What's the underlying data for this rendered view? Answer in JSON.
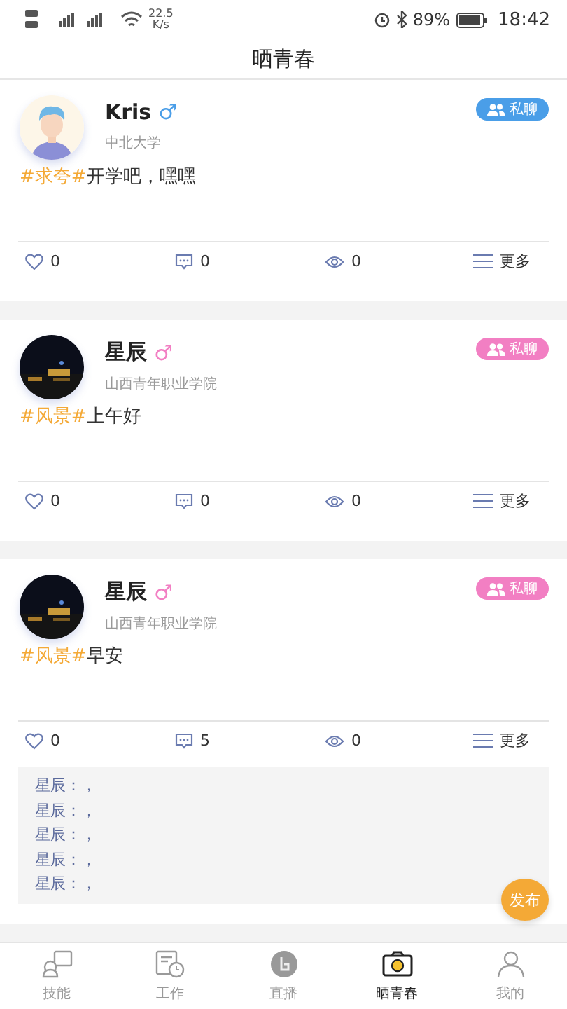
{
  "status_bar": {
    "speed": "22.5",
    "speed_unit": "K/s",
    "battery": "89%",
    "time": "18:42"
  },
  "header": {
    "title": "晒青春"
  },
  "posts": [
    {
      "name": "Kris",
      "gender": "♂",
      "color": "#4a9ee8",
      "school": "中北大学",
      "chat": "私聊",
      "topic": "#求夸#",
      "text": "开学吧，嘿嘿",
      "likes": "0",
      "comments": "0",
      "views": "0",
      "more": "更多"
    },
    {
      "name": "星辰",
      "gender": "♂",
      "color": "#f27fc3",
      "school": "山西青年职业学院",
      "chat": "私聊",
      "topic": "#风景#",
      "text": "上午好",
      "likes": "0",
      "comments": "0",
      "views": "0",
      "more": "更多"
    },
    {
      "name": "星辰",
      "gender": "♂",
      "color": "#f27fc3",
      "school": "山西青年职业学院",
      "chat": "私聊",
      "topic": "#风景#",
      "text": "早安",
      "likes": "0",
      "comments": "5",
      "views": "0",
      "more": "更多",
      "replies": [
        "星辰：，",
        "星辰：，",
        "星辰：，",
        "星辰：，",
        "星辰：，"
      ]
    }
  ],
  "fab": {
    "label": "发布"
  },
  "tabs": [
    {
      "label": "技能",
      "selected": false
    },
    {
      "label": "工作",
      "selected": false
    },
    {
      "label": "直播",
      "selected": false
    },
    {
      "label": "晒青春",
      "selected": true
    },
    {
      "label": "我的",
      "selected": false
    }
  ]
}
